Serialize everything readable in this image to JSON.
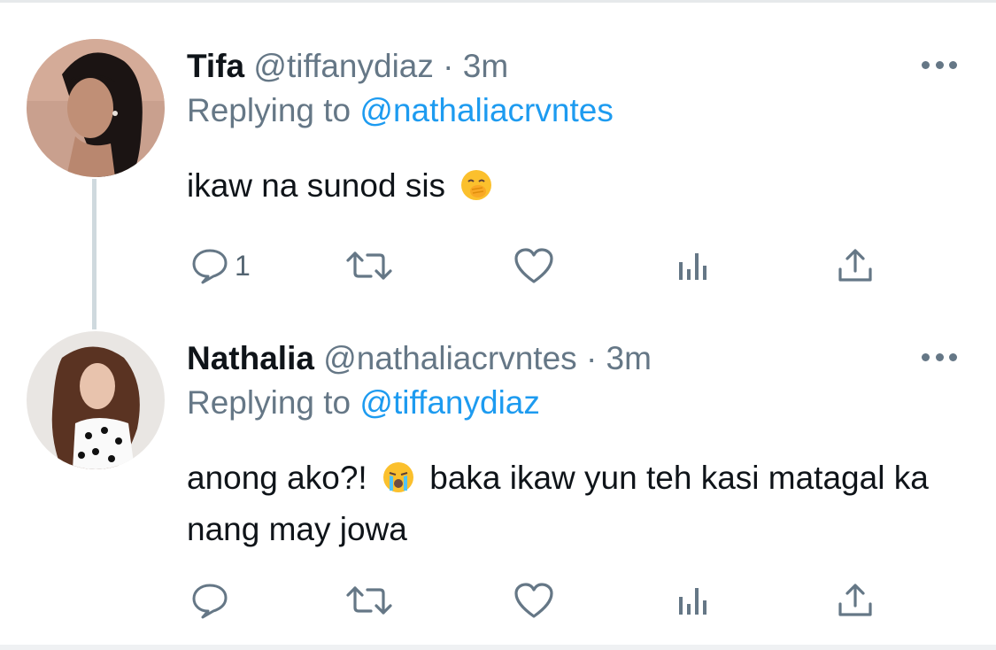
{
  "colors": {
    "text": "#0f1419",
    "secondary": "#657786",
    "link": "#1d9bf0",
    "thread_line": "#cfd9de"
  },
  "tweets": [
    {
      "display_name": "Tifa",
      "handle": "@tiffanydiaz",
      "separator": "·",
      "time": "3m",
      "replying_prefix": "Replying to",
      "replying_to": "@nathaliacrvntes",
      "text": "ikaw na sunod sis",
      "emoji": "face-with-hand-over-mouth",
      "reply_count": "1"
    },
    {
      "display_name": "Nathalia",
      "handle": "@nathaliacrvntes",
      "separator": "·",
      "time": "3m",
      "replying_prefix": "Replying to",
      "replying_to": "@tiffanydiaz",
      "text_before_emoji": "anong ako?!",
      "emoji": "loudly-crying-face",
      "text_after_emoji": "baka ikaw yun teh kasi matagal ka nang may jowa",
      "reply_count": ""
    }
  ],
  "icons": {
    "more": "more-horizontal-icon",
    "reply": "reply-bubble-icon",
    "retweet": "retweet-icon",
    "like": "heart-icon",
    "stats": "analytics-icon",
    "share": "share-icon"
  }
}
